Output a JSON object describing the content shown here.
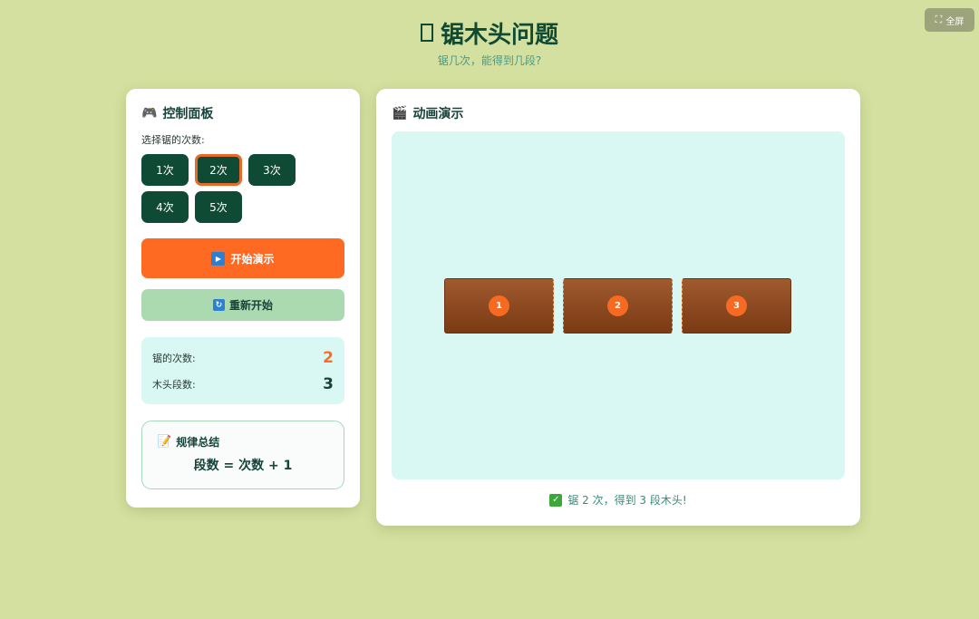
{
  "fullscreen": {
    "label": "全屏",
    "icon": "fullscreen-icon"
  },
  "header": {
    "title": "锯木头问题",
    "subtitle": "锯几次，能得到几段?"
  },
  "controls": {
    "title": "控制面板",
    "title_icon": "🎮",
    "select_label": "选择锯的次数:",
    "count_options": [
      "1次",
      "2次",
      "3次",
      "4次",
      "5次"
    ],
    "selected_option": "2次",
    "start_label": "开始演示",
    "reset_label": "重新开始",
    "stats": {
      "cuts_label": "锯的次数:",
      "cuts_value": "2",
      "pieces_label": "木头段数:",
      "pieces_value": "3"
    },
    "rule": {
      "title": "规律总结",
      "formula": "段数 = 次数 + 1"
    }
  },
  "animation": {
    "title": "动画演示",
    "title_icon": "🎬",
    "log_numbers": [
      "1",
      "2",
      "3"
    ],
    "result_text": "锯 2 次，得到 3 段木头!"
  },
  "colors": {
    "background": "#d4e09f",
    "button_dark": "#0f4a35",
    "accent_orange": "#ff6a22",
    "reset_green": "#acdab0",
    "stage_bg": "#d9f8f3"
  }
}
